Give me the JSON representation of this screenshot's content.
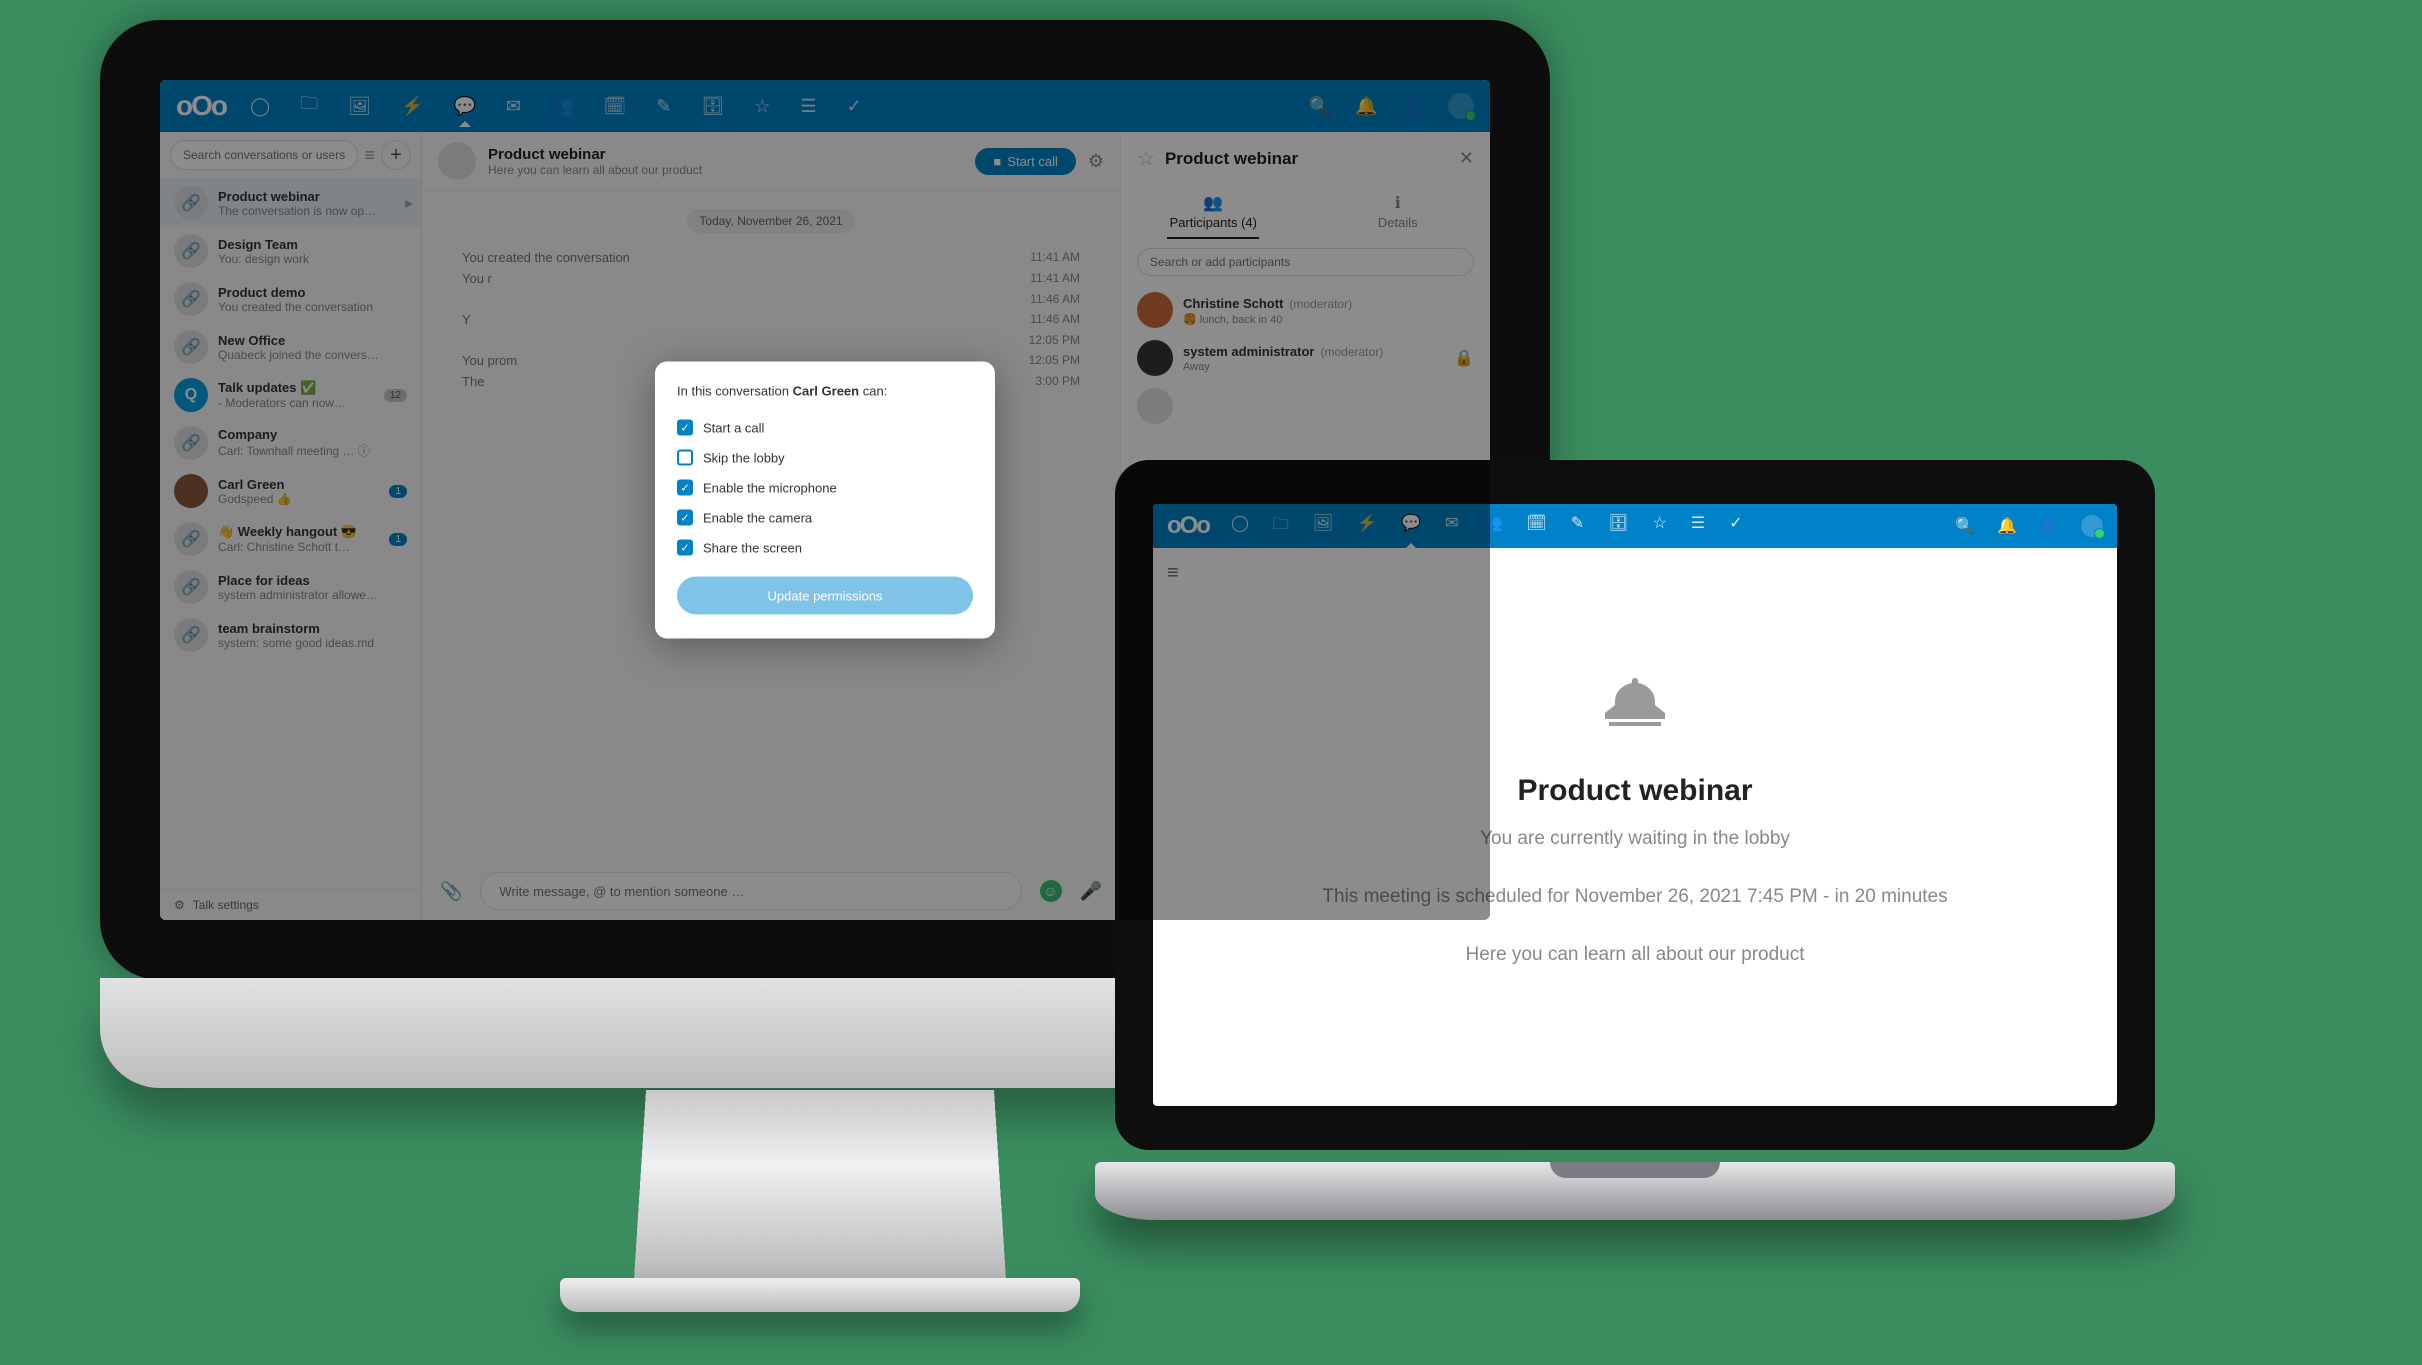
{
  "imac": {
    "search_placeholder": "Search conversations or users",
    "conversations": [
      {
        "title": "Product webinar",
        "sub": "The conversation is now op…"
      },
      {
        "title": "Design Team",
        "sub": "You: design work"
      },
      {
        "title": "Product demo",
        "sub": "You created the conversation"
      },
      {
        "title": "New Office",
        "sub": "Quabeck joined the convers…"
      },
      {
        "title": "Talk updates ✅",
        "sub": "- Moderators can now… ",
        "badge": "12",
        "badge_grey": true,
        "avatar": "q"
      },
      {
        "title": "Company",
        "sub": "Carl: Townhall meeting … ⓘ"
      },
      {
        "title": "Carl Green",
        "sub": "Godspeed 👍",
        "badge": "1",
        "avatar": "user"
      },
      {
        "title": "👋 Weekly hangout 😎",
        "sub": "Carl: Christine Schott t…",
        "badge": "1"
      },
      {
        "title": "Place for ideas",
        "sub": "system administrator allowe…"
      },
      {
        "title": "team brainstorm",
        "sub": "system: some good ideas.md"
      }
    ],
    "settings_label": "Talk settings",
    "head": {
      "title": "Product webinar",
      "sub": "Here you can learn all about our product",
      "start_call": "Start call"
    },
    "date_pill": "Today, November 26, 2021",
    "events": [
      {
        "lbl": "You created the conversation",
        "time": "11:41 AM"
      },
      {
        "lbl": "",
        "time": "11:41 AM",
        "indent": "You r"
      },
      {
        "lbl": "",
        "time": "11:46 AM"
      },
      {
        "lbl": "",
        "time": "11:46 AM",
        "indent": "Y"
      },
      {
        "lbl": "",
        "time": "12:05 PM"
      },
      {
        "lbl": "",
        "time": "12:05 PM",
        "indent": "You prom"
      },
      {
        "lbl": "",
        "time": "3:00 PM",
        "indent": "The"
      }
    ],
    "compose_placeholder": "Write message, @ to mention someone …",
    "right": {
      "title": "Product webinar",
      "tab_participants": "Participants (4)",
      "tab_details": "Details",
      "search_placeholder": "Search or add participants",
      "participants": [
        {
          "name": "Christine Schott",
          "mod": "(moderator)",
          "status": "🍔 lunch, back in 40"
        },
        {
          "name": "system administrator",
          "mod": "(moderator)",
          "status": "Away",
          "lock": true
        }
      ]
    },
    "modal": {
      "lead_prefix": "In this conversation ",
      "lead_name": "Carl Green",
      "lead_suffix": " can:",
      "opts": [
        {
          "label": "Start a call",
          "on": true
        },
        {
          "label": "Skip the lobby",
          "on": false
        },
        {
          "label": "Enable the microphone",
          "on": true
        },
        {
          "label": "Enable the camera",
          "on": true
        },
        {
          "label": "Share the screen",
          "on": true
        }
      ],
      "button": "Update permissions"
    }
  },
  "macbook": {
    "title": "Product webinar",
    "line1": "You are currently waiting in the lobby",
    "line2": "This meeting is scheduled for November 26, 2021 7:45 PM - in 20 minutes",
    "line3": "Here you can learn all about our product"
  }
}
